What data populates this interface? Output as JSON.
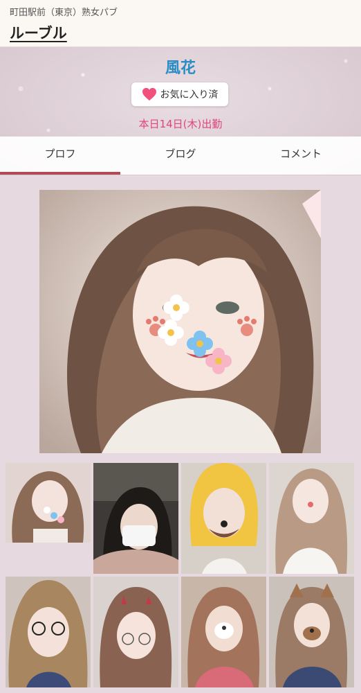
{
  "header": {
    "area_text": "町田駅前（東京）熟女パブ",
    "shop_name": "ルーブル"
  },
  "profile": {
    "name": "風花",
    "favorite_label": "お気に入り済",
    "schedule": "本日14日(木)出勤"
  },
  "tabs": [
    {
      "label": "プロフ",
      "active": true
    },
    {
      "label": "ブログ",
      "active": false
    },
    {
      "label": "コメント",
      "active": false
    }
  ],
  "colors": {
    "name": "#2a8cc4",
    "schedule": "#e0457a",
    "heart": "#f0517d",
    "tab_indicator": "#b24a55"
  },
  "photos": {
    "main": "profile-photo",
    "thumbnail_count": 8
  }
}
